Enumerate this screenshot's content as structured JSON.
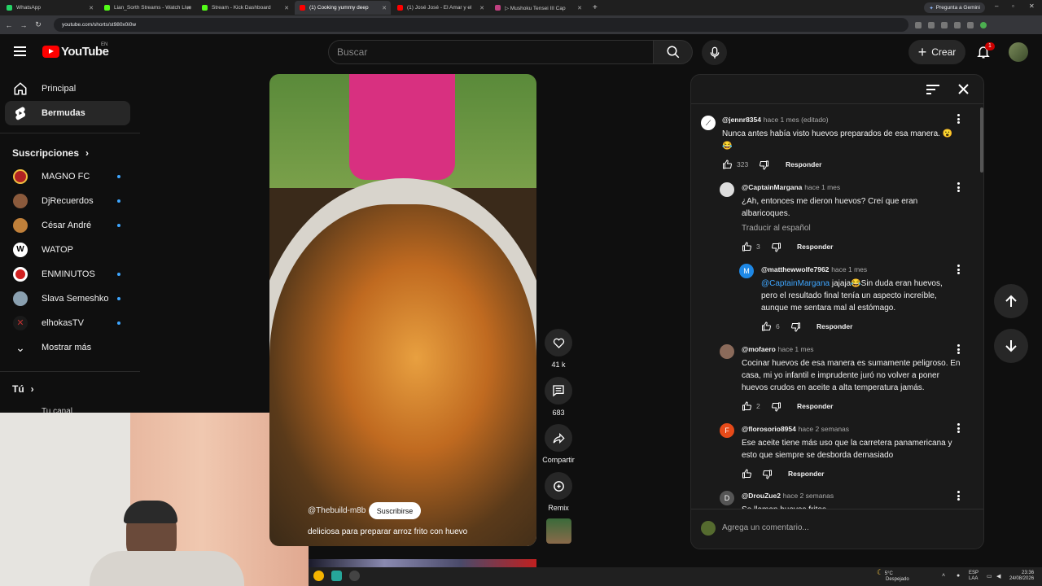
{
  "browser": {
    "tabs": [
      {
        "label": "WhatsApp",
        "color": "#25d366"
      },
      {
        "label": "Lian_Sorth Streams - Watch Live",
        "color": "#53fc18"
      },
      {
        "label": "Stream - Kick Dashboard",
        "color": "#53fc18"
      },
      {
        "label": "(1) Cooking yummy deep",
        "color": "#ff0000"
      },
      {
        "label": "(1) José José - El Amar y el",
        "color": "#ff0000"
      },
      {
        "label": "▷ Mushoku Tensei III Cap",
        "color": "#c04080"
      }
    ],
    "new_tab": "+",
    "gemini_label": "Pregunta a Gemini",
    "url": "youtube.com/shorts/st980x0i0w"
  },
  "header": {
    "logo_text": "YouTube",
    "country": "EN",
    "search_placeholder": "Buscar",
    "create_label": "Crear",
    "notif_count": "1"
  },
  "sidebar": {
    "items": [
      {
        "label": "Principal",
        "icon": "home-icon"
      },
      {
        "label": "Bermudas",
        "icon": "shorts-icon"
      }
    ],
    "subs_heading": "Suscripciones",
    "subs": [
      {
        "label": "MAGNO FC",
        "color": "#b22222",
        "dot": true
      },
      {
        "label": "DjRecuerdos",
        "color": "#8b5a3c",
        "dot": true
      },
      {
        "label": "César André",
        "color": "#c0803a",
        "dot": true
      },
      {
        "label": "WATOP",
        "color": "#ffffff",
        "dot": false
      },
      {
        "label": "ENMINUTOS",
        "color": "#d02020",
        "dot": true
      },
      {
        "label": "Slava Semeshko",
        "color": "#8aa0b0",
        "dot": true
      },
      {
        "label": "elhokasTV",
        "color": "#c03030",
        "dot": true
      }
    ],
    "show_more": "Mostrar más",
    "you_heading": "Tú",
    "your_channel": "Tu canal"
  },
  "short": {
    "channel": "@Thebuild-m8b",
    "subscribe": "Suscribirse",
    "caption": "deliciosa para preparar arroz frito con huevo",
    "likes": "41 k",
    "comments": "683",
    "share": "Compartir",
    "remix": "Remix"
  },
  "comments": {
    "items": [
      {
        "handle": "@jennr8354",
        "time": "hace 1 mes (editado)",
        "lines": [
          "Nunca antes había visto huevos preparados de esa manera. 😮",
          "😂"
        ],
        "likes": "323",
        "reply": "Responder"
      },
      {
        "handle": "@CaptainMargana",
        "time": "hace 1 mes",
        "lines": [
          "¿Ah, entonces me dieron huevos? Creí que eran",
          "albaricoques."
        ],
        "translate": "Traducir al español",
        "likes": "3",
        "reply": "Responder"
      },
      {
        "handle": "@matthewwolfe7962",
        "time": "hace 1 mes",
        "mention": "@CaptainMargana",
        "lines": [
          " jajaja😂Sin duda eran huevos,",
          "pero el resultado final tenía un aspecto increíble,",
          "aunque me sentara mal al estómago."
        ],
        "likes": "6",
        "reply": "Responder",
        "initial": "M"
      },
      {
        "handle": "@mofaero",
        "time": "hace 1 mes",
        "lines": [
          "Cocinar huevos de esa manera es sumamente peligroso. En",
          "casa, mi yo infantil e imprudente juró no volver a poner",
          "huevos crudos en aceite a alta temperatura jamás."
        ],
        "likes": "2",
        "reply": "Responder"
      },
      {
        "handle": "@florosorio8954",
        "time": "hace 2 semanas",
        "lines": [
          "Ese aceite tiene más uso que la carretera panamericana y",
          "esto que siempre se desborda demasiado"
        ],
        "reply": "Responder",
        "initial": "F"
      },
      {
        "handle": "@DrouZue2",
        "time": "hace 2 semanas",
        "lines": [
          "Se llaman huevos fritos"
        ],
        "initial": "D"
      }
    ],
    "add_placeholder": "Agrega un comentario..."
  },
  "taskbar": {
    "temp": "5°C",
    "weather": "Despejado",
    "lang1": "ESP",
    "lang2": "LAA",
    "time": "23:36",
    "date": "24/08/2026"
  }
}
